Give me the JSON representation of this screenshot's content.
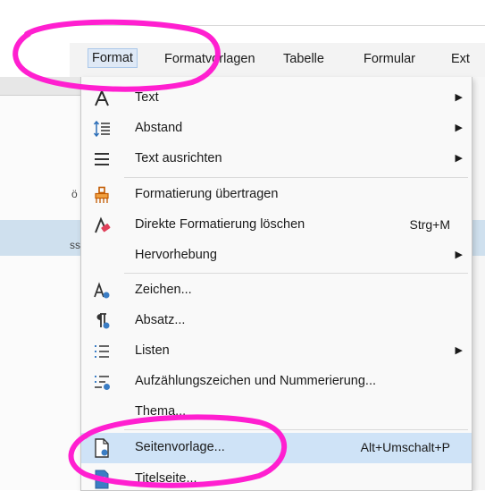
{
  "menubar": {
    "items": [
      {
        "label": "Format"
      },
      {
        "label": "Formatvorlagen"
      },
      {
        "label": "Tabelle"
      },
      {
        "label": "Formular"
      },
      {
        "label": "Ext"
      }
    ]
  },
  "menu": {
    "items": [
      {
        "label": "Text",
        "icon": "text-a-icon",
        "submenu": true
      },
      {
        "label": "Abstand",
        "icon": "spacing-icon",
        "submenu": true
      },
      {
        "label": "Text ausrichten",
        "icon": "align-icon",
        "submenu": true
      },
      {
        "label": "Formatierung übertragen",
        "icon": "clone-formatting-icon"
      },
      {
        "label": "Direkte Formatierung löschen",
        "icon": "clear-formatting-icon",
        "shortcut": "Strg+M"
      },
      {
        "label": "Hervorhebung",
        "submenu": true
      },
      {
        "label": "Zeichen...",
        "icon": "character-icon"
      },
      {
        "label": "Absatz...",
        "icon": "paragraph-icon"
      },
      {
        "label": "Listen",
        "icon": "list-icon",
        "submenu": true
      },
      {
        "label": "Aufzählungszeichen und Nummerierung...",
        "icon": "bullets-numbering-icon"
      },
      {
        "label": "Thema..."
      },
      {
        "label": "Seitenvorlage...",
        "icon": "page-style-icon",
        "shortcut": "Alt+Umschalt+P",
        "highlighted": true
      },
      {
        "label": "Titelseite...",
        "icon": "title-page-icon"
      }
    ]
  },
  "doc": {
    "fragment_1": "ö",
    "fragment_2": "ss"
  },
  "colors": {
    "highlight": "#cfe3f7",
    "annotation": "#ff1fd0",
    "menu_bg": "#f9f9f9"
  }
}
